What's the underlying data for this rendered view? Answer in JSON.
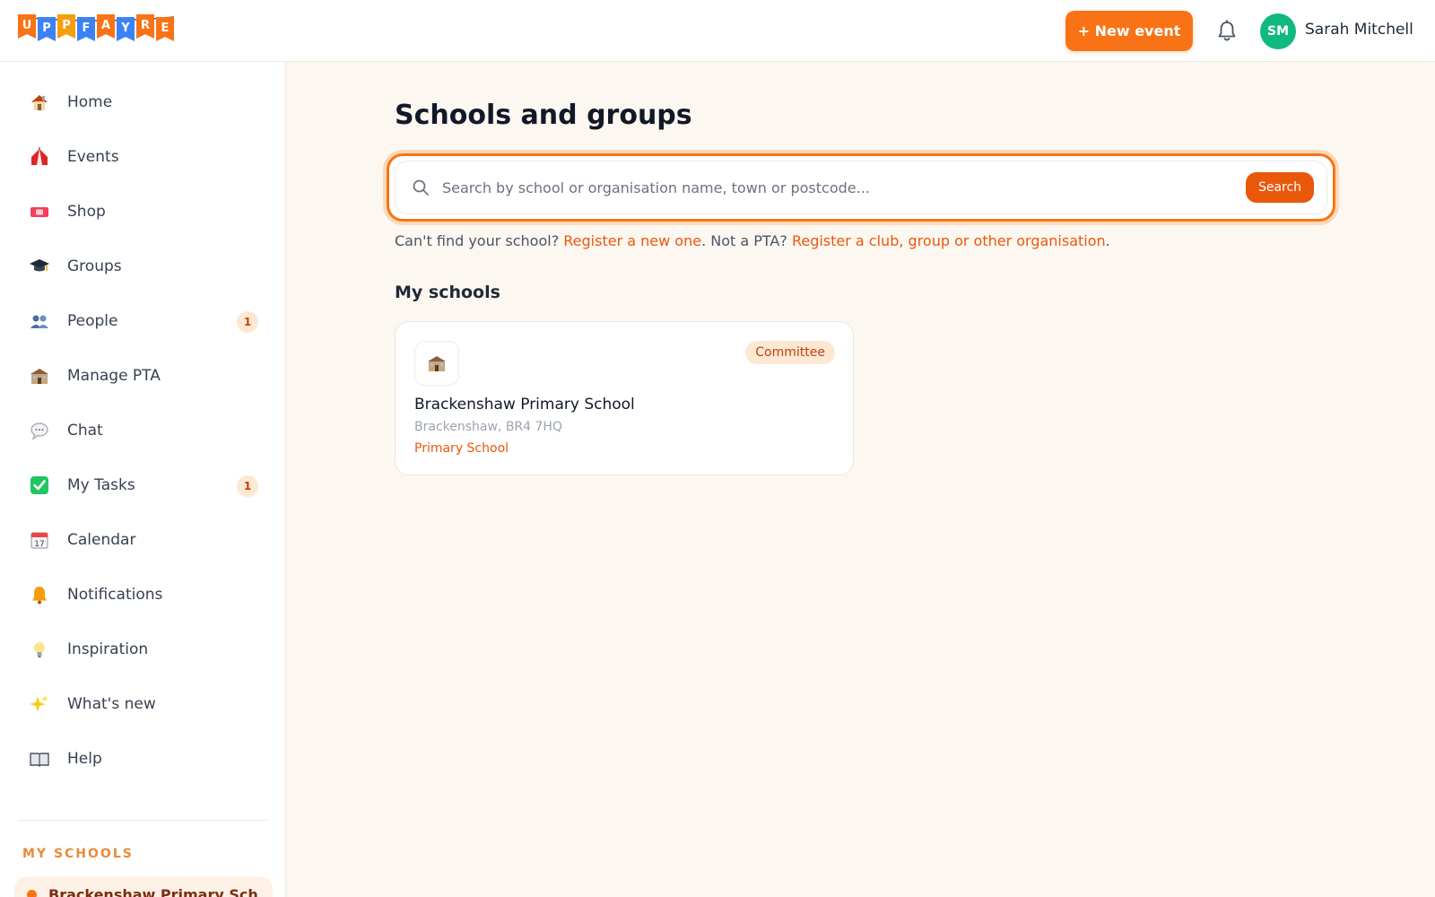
{
  "header": {
    "logo_letters": [
      "U",
      "P",
      "F",
      "A",
      "Y",
      "R",
      "E"
    ],
    "logo_colors": [
      "#f97316",
      "#3b82f6",
      "#f59e0b",
      "#3b82f6",
      "#f97316",
      "#3b82f6",
      "#f97316"
    ],
    "new_event_label": "+ New event",
    "avatar_initials": "SM",
    "user_name": "Sarah Mitchell"
  },
  "sidebar": {
    "items": [
      {
        "label": "Home",
        "icon": "house-icon",
        "badge": ""
      },
      {
        "label": "Events",
        "icon": "circus-tent-icon",
        "badge": ""
      },
      {
        "label": "Shop",
        "icon": "ticket-icon",
        "badge": ""
      },
      {
        "label": "Groups",
        "icon": "graduation-cap-icon",
        "badge": ""
      },
      {
        "label": "People",
        "icon": "people-icon",
        "badge": "1"
      },
      {
        "label": "Manage PTA",
        "icon": "school-icon",
        "badge": ""
      },
      {
        "label": "Chat",
        "icon": "speech-bubble-icon",
        "badge": ""
      },
      {
        "label": "My Tasks",
        "icon": "check-box-icon",
        "badge": "1"
      },
      {
        "label": "Calendar",
        "icon": "calendar-icon",
        "badge": ""
      },
      {
        "label": "Notifications",
        "icon": "bell-icon",
        "badge": ""
      },
      {
        "label": "Inspiration",
        "icon": "lightbulb-icon",
        "badge": ""
      },
      {
        "label": "What's new",
        "icon": "sparkles-icon",
        "badge": ""
      },
      {
        "label": "Help",
        "icon": "book-icon",
        "badge": ""
      }
    ],
    "section_title": "MY SCHOOLS",
    "school_pill": "Brackenshaw Primary Sch"
  },
  "main": {
    "title": "Schools and groups",
    "search": {
      "placeholder": "Search by school or organisation name, town or postcode...",
      "button": "Search"
    },
    "help": {
      "prefix": "Can't find your school?",
      "link1": "Register a new one",
      "middle": ". Not a PTA?",
      "link2": "Register a club, group or other organisation",
      "suffix": "."
    },
    "my_schools_title": "My schools",
    "schools": [
      {
        "name": "Brackenshaw Primary School",
        "location": "Brackenshaw, BR4 7HQ",
        "type": "Primary School",
        "role": "Committee"
      }
    ]
  },
  "colors": {
    "accent": "#f97316",
    "accent_dark": "#ea580c",
    "avatar": "#10b981",
    "page_bg": "#fdf7f1"
  }
}
